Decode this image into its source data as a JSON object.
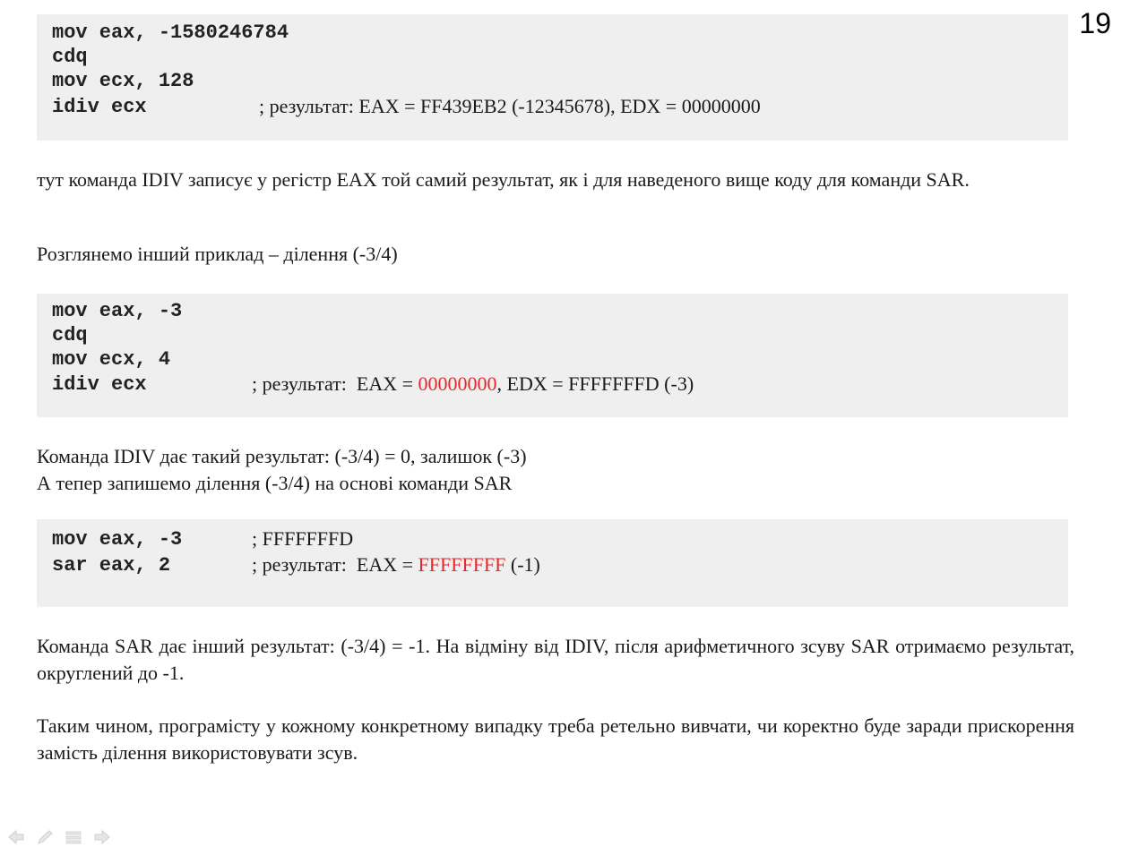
{
  "slide_number": "19",
  "block1": {
    "lines": [
      "mov eax, -1580246784",
      "cdq",
      "mov ecx, 128",
      "idiv ecx"
    ],
    "comment": "; результат: EAX = FF439EB2 (-12345678), EDX = 00000000"
  },
  "para1": "тут команда IDIV записує у регістр EAX той самий результат, як і для наведеного вище коду для команди SAR.",
  "para2": "Розглянемо інший приклад – ділення (-3/4)",
  "block2": {
    "lines": [
      "mov eax, -3",
      "cdq",
      "mov ecx, 4",
      "idiv ecx"
    ],
    "comment_prefix": "; результат:  EAX = ",
    "comment_red": "00000000",
    "comment_suffix": ", EDX = FFFFFFFD (-3)"
  },
  "para3_line1": "Команда IDIV дає такий результат:  (-3/4) = 0, залишок (-3)",
  "para3_line2": "А тепер запишемо ділення (-3/4)  на основі команди SAR",
  "block3": {
    "line1": "mov eax, -3",
    "comment1": "; FFFFFFFD",
    "line2": "sar eax, 2",
    "comment2_prefix": "; результат:  EAX = ",
    "comment2_red": "FFFFFFFF",
    "comment2_suffix": " (-1)"
  },
  "para4": "Команда SAR дає інший результат:  (-3/4) = -1. На відміну від IDIV, після арифметичного зсуву SAR отримаємо результат, округлений до -1.",
  "para5": "Таким чином, програмісту у кожному конкретному випадку треба ретельно вивчати, чи коректно буде заради прискорення замість ділення використовувати зсув.",
  "nav_icons": [
    "arrow-left-icon",
    "pen-icon",
    "menu-icon",
    "arrow-right-icon"
  ],
  "colors": {
    "code_bg": "#efefef",
    "highlight_red": "#e8272b"
  }
}
